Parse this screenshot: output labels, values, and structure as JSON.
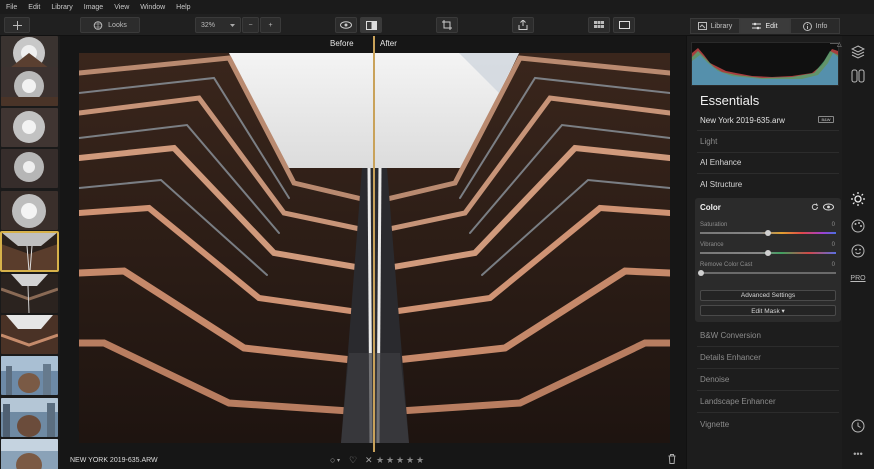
{
  "menu": [
    "File",
    "Edit",
    "Library",
    "Image",
    "View",
    "Window",
    "Help"
  ],
  "toolbar": {
    "looks_label": "Looks",
    "zoom_value": "32%",
    "zoom_minus": "−",
    "zoom_plus": "+"
  },
  "panel_tabs": [
    {
      "label": "Library",
      "icon": "library-icon"
    },
    {
      "label": "Edit",
      "icon": "sliders-icon"
    },
    {
      "label": "Info",
      "icon": "info-icon"
    }
  ],
  "viewer": {
    "before_label": "Before",
    "after_label": "After"
  },
  "statusbar": {
    "filename": "NEW YORK 2019-635.ARW",
    "rating": 0
  },
  "essentials": {
    "title": "Essentials",
    "file_name": "New York 2019-635.arw",
    "bw_badge": "B&W",
    "sections_top": [
      "Light",
      "AI Enhance",
      "AI Structure"
    ],
    "color": {
      "title": "Color",
      "sliders": [
        {
          "label": "Saturation",
          "value": "0",
          "position": 0.5
        },
        {
          "label": "Vibrance",
          "value": "0",
          "position": 0.5
        },
        {
          "label": "Remove Color Cast",
          "value": "0",
          "position": 0.0
        }
      ],
      "advanced_button": "Advanced Settings",
      "edit_mask_button": "Edit Mask ▾"
    },
    "sections_bottom": [
      "B&W Conversion",
      "Details Enhancer",
      "Denoise",
      "Landscape Enhancer",
      "Vignette"
    ]
  },
  "rail": {
    "pro_label": "PRO"
  },
  "colors": {
    "accent": "#d7b24a",
    "split_line": "#c9a25a",
    "panel_bg": "#1d1d1d"
  }
}
